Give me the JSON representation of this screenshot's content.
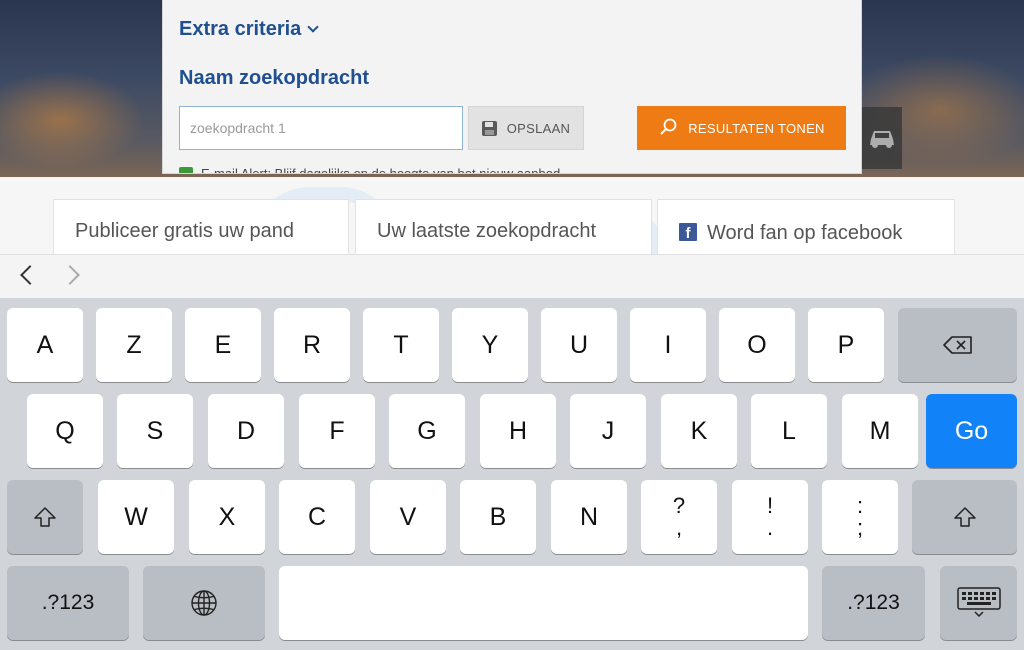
{
  "search": {
    "extra_criteria_label": "Extra criteria",
    "naam_label": "Naam zoekopdracht",
    "query_placeholder": "zoekopdracht 1",
    "save_label": "OPSLAAN",
    "results_label": "RESULTATEN TONEN",
    "email_alert_text": "E-mail Alert: Blijf dagelijks op de hoogte van het nieuw aanbod"
  },
  "promos": {
    "publish": "Publiceer gratis uw pand",
    "last_search": "Uw laatste zoekopdracht",
    "facebook": "Word fan op facebook",
    "facebook_icon_letter": "f"
  },
  "keyboard": {
    "row1": [
      "A",
      "Z",
      "E",
      "R",
      "T",
      "Y",
      "U",
      "I",
      "O",
      "P"
    ],
    "row2": [
      "Q",
      "S",
      "D",
      "F",
      "G",
      "H",
      "J",
      "K",
      "L",
      "M"
    ],
    "go_label": "Go",
    "row3": [
      "W",
      "X",
      "C",
      "V",
      "B",
      "N"
    ],
    "punct": [
      {
        "top": "?",
        "bottom": ","
      },
      {
        "top": "!",
        "bottom": "."
      },
      {
        "top": ":",
        "bottom": ";"
      }
    ],
    "numbers_label": ".?123"
  },
  "colors": {
    "brand_blue": "#1f4f8f",
    "accent_orange": "#ee7b14",
    "go_blue": "#1282f8",
    "facebook_blue": "#3b5998"
  },
  "icons": [
    "chevron-down-icon",
    "save-icon",
    "search-icon",
    "checkbox-icon",
    "car-icon",
    "facebook-icon",
    "back-arrow-icon",
    "forward-arrow-icon",
    "backspace-icon",
    "shift-icon",
    "globe-icon",
    "keyboard-hide-icon"
  ]
}
